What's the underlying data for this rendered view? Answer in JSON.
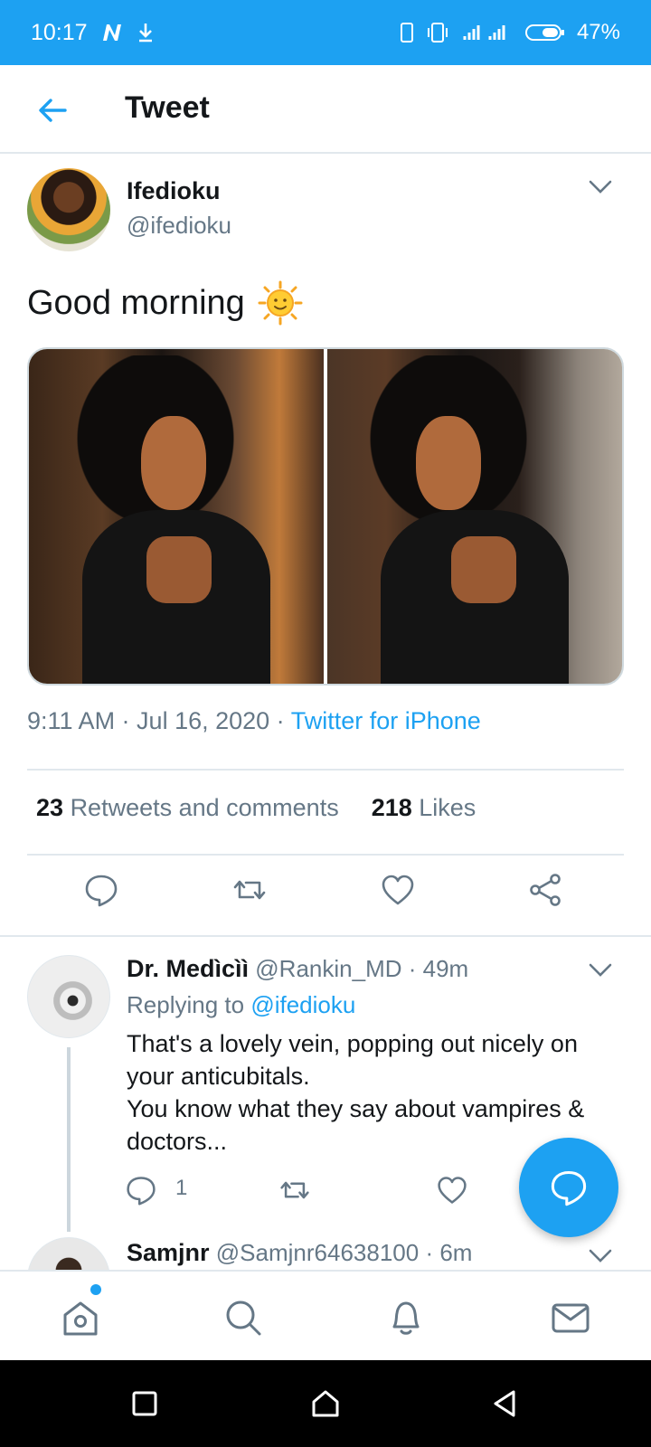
{
  "status_bar": {
    "time": "10:17",
    "battery": "47%",
    "icons": [
      "n-icon",
      "download-icon",
      "vibrate-icon",
      "signal-icon",
      "battery-icon"
    ]
  },
  "header": {
    "title": "Tweet"
  },
  "tweet": {
    "author_name": "Ifedioku",
    "author_handle": "@ifedioku",
    "text": "Good morning",
    "emoji": "sun-with-face",
    "timestamp": "9:11 AM · Jul 16, 2020 · ",
    "source": "Twitter for iPhone",
    "retweets_count": "23",
    "retweets_label": "Retweets and comments",
    "likes_count": "218",
    "likes_label": "Likes"
  },
  "reply": {
    "name": "Dr. Medìcìì",
    "handle": "@Rankin_MD",
    "time": " · 49m",
    "replying_prefix": "Replying to ",
    "replying_to": "@ifedioku",
    "text_line1": "That's a lovely vein, popping out nicely on your anticubitals.",
    "text_line2": "You know what they say about vampires & doctors...",
    "reply_count": "1"
  },
  "reply2": {
    "name": "Samjnr",
    "handle": "@Samjnr64638100",
    "time": " · 6m"
  },
  "colors": {
    "accent": "#1da1f2",
    "text_primary": "#14171a",
    "text_secondary": "#657786",
    "divider": "#e1e8ed"
  }
}
